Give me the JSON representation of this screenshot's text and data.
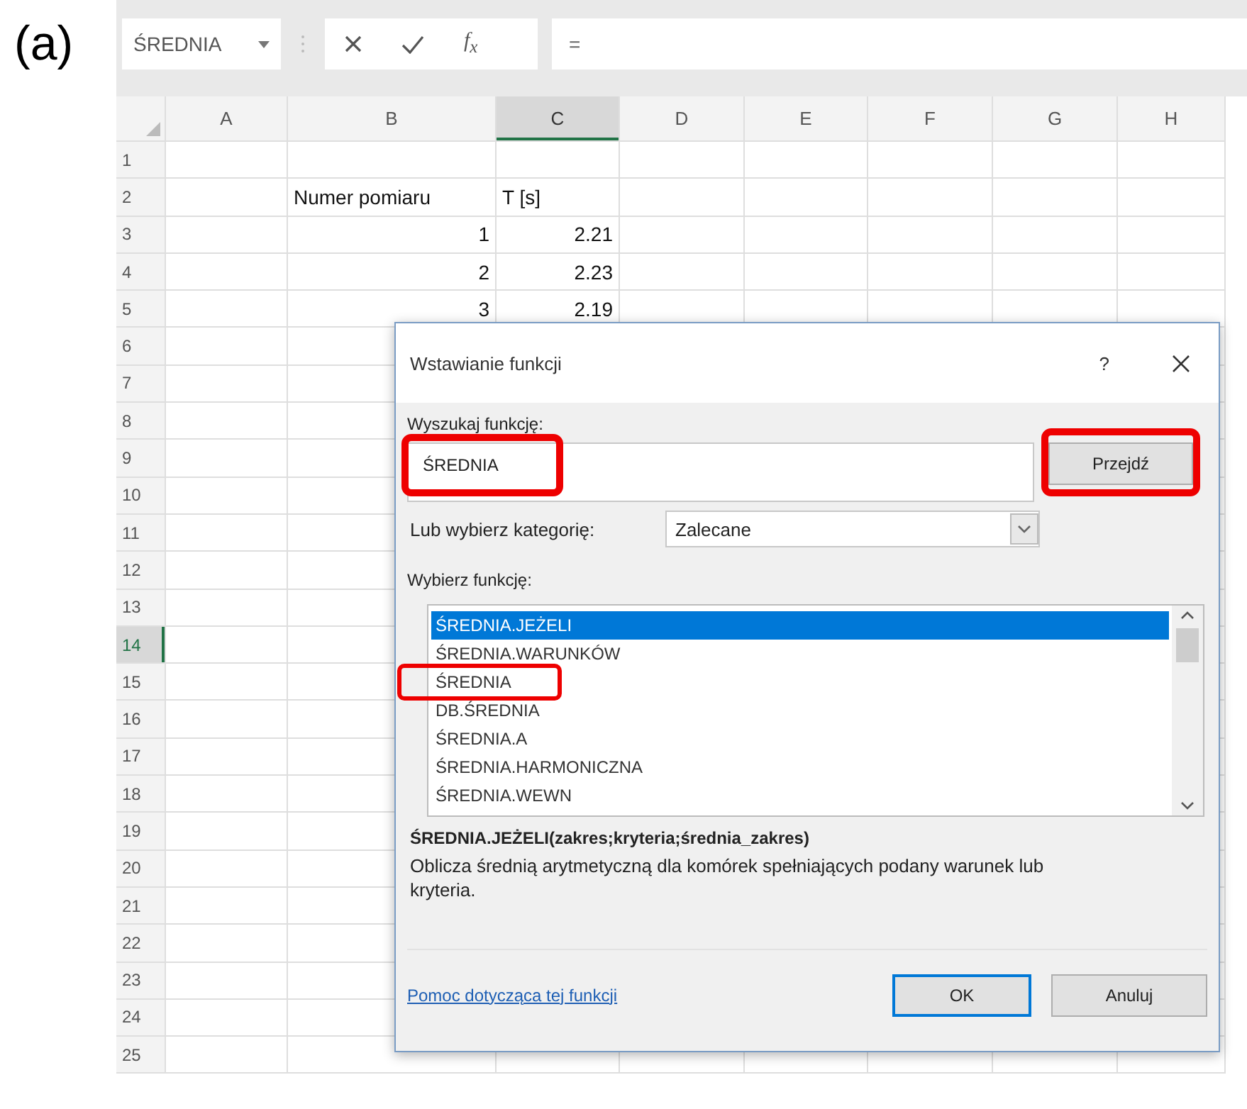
{
  "figure_label": "(a)",
  "formula_bar": {
    "name_box": "ŚREDNIA",
    "fx": "f$_{x}$",
    "formula": "="
  },
  "columns": [
    {
      "label": "A",
      "selected": false
    },
    {
      "label": "B",
      "selected": false
    },
    {
      "label": "C",
      "selected": true
    },
    {
      "label": "D",
      "selected": false
    },
    {
      "label": "E",
      "selected": false
    },
    {
      "label": "F",
      "selected": false
    },
    {
      "label": "G",
      "selected": false
    },
    {
      "label": "H",
      "selected": false
    }
  ],
  "rows": [
    {
      "label": "1",
      "selected": false
    },
    {
      "label": "2",
      "selected": false,
      "cells": [
        {
          "kind": "text",
          "text": "Numer pomiaru"
        },
        {
          "kind": "text",
          "text": "T [s]"
        }
      ]
    },
    {
      "label": "3",
      "selected": false,
      "cells": [
        {
          "kind": "number",
          "text": "1"
        },
        {
          "kind": "number",
          "text": "2.21"
        }
      ]
    },
    {
      "label": "4",
      "selected": false,
      "cells": [
        {
          "kind": "number",
          "text": "2"
        },
        {
          "kind": "number",
          "text": "2.23"
        }
      ]
    },
    {
      "label": "5",
      "selected": false,
      "cells": [
        {
          "kind": "number",
          "text": "3"
        },
        {
          "kind": "number",
          "text": "2.19"
        }
      ]
    },
    {
      "label": "6",
      "selected": false
    },
    {
      "label": "7",
      "selected": false
    },
    {
      "label": "8",
      "selected": false
    },
    {
      "label": "9",
      "selected": false
    },
    {
      "label": "10",
      "selected": false
    },
    {
      "label": "11",
      "selected": false
    },
    {
      "label": "12",
      "selected": false
    },
    {
      "label": "13",
      "selected": false
    },
    {
      "label": "14",
      "selected": true
    },
    {
      "label": "15",
      "selected": false
    },
    {
      "label": "16",
      "selected": false
    },
    {
      "label": "17",
      "selected": false
    },
    {
      "label": "18",
      "selected": false
    },
    {
      "label": "19",
      "selected": false
    },
    {
      "label": "20",
      "selected": false
    },
    {
      "label": "21",
      "selected": false
    },
    {
      "label": "22",
      "selected": false
    },
    {
      "label": "23",
      "selected": false
    },
    {
      "label": "24",
      "selected": false
    },
    {
      "label": "25",
      "selected": false
    }
  ],
  "dialog": {
    "title": "Wstawianie funkcji",
    "help": "?",
    "search_label": "Wyszukaj funkcję:",
    "search": {
      "value": "ŚREDNIA",
      "highlighted": true
    },
    "go_button": {
      "label": "Przejdź",
      "highlighted": true
    },
    "category_label": "Lub wybierz kategorię:",
    "category": "Zalecane",
    "list_label": "Wybierz funkcję:",
    "functions": [
      {
        "label": "ŚREDNIA.JEŻELI",
        "selected": true,
        "highlighted": false
      },
      {
        "label": "ŚREDNIA.WARUNKÓW",
        "selected": false,
        "highlighted": false
      },
      {
        "label": "ŚREDNIA",
        "selected": false,
        "highlighted": true
      },
      {
        "label": "DB.ŚREDNIA",
        "selected": false,
        "highlighted": false
      },
      {
        "label": "ŚREDNIA.A",
        "selected": false,
        "highlighted": false
      },
      {
        "label": "ŚREDNIA.HARMONICZNA",
        "selected": false,
        "highlighted": false
      },
      {
        "label": "ŚREDNIA.WEWN",
        "selected": false,
        "highlighted": false
      }
    ],
    "signature": "ŚREDNIA.JEŻELI(zakres;kryteria;średnia_zakres)",
    "description": "Oblicza średnią arytmetyczną dla komórek spełniających podany warunek lub kryteria.",
    "help_link": "Pomoc dotycząca tej funkcji",
    "buttons": [
      {
        "label": "OK",
        "default": true
      },
      {
        "label": "Anuluj",
        "default": false
      }
    ]
  }
}
